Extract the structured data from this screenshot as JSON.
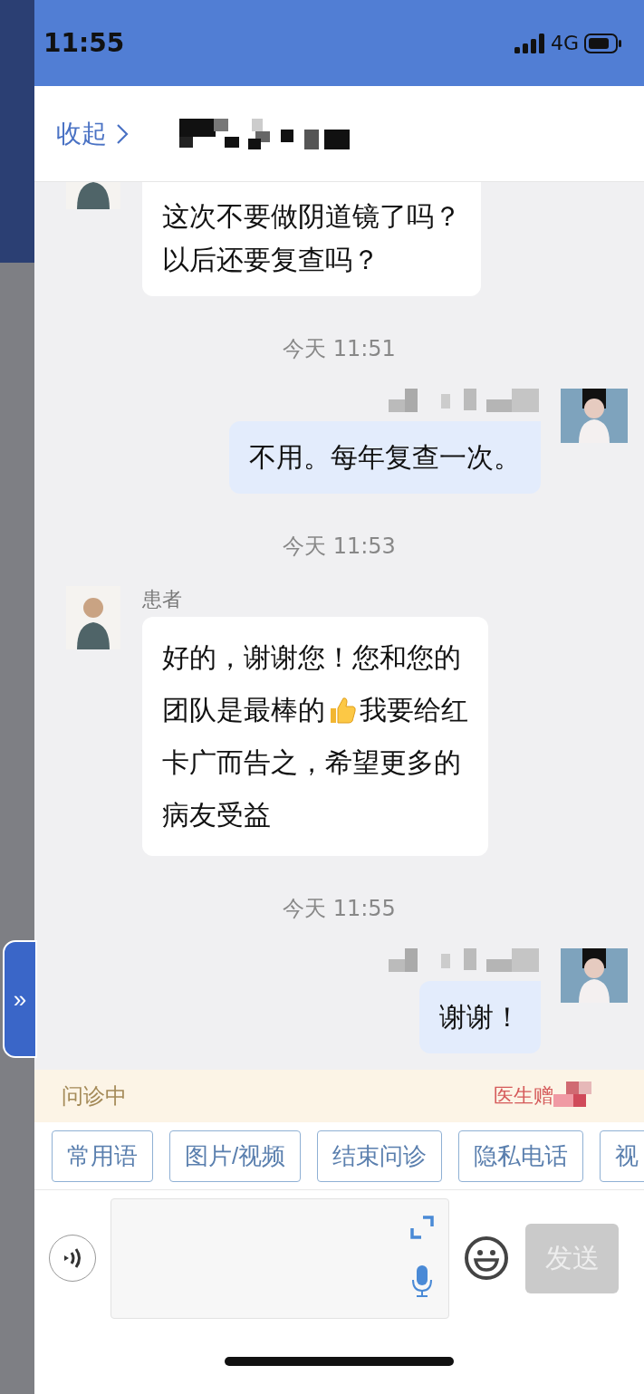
{
  "status_bar": {
    "time": "11:55",
    "network": "4G"
  },
  "header": {
    "collapse_label": "收起"
  },
  "side_tab": {
    "label": "»"
  },
  "messages": [
    {
      "kind": "incoming",
      "lines": [
        "这次不要做阴道镜了吗？",
        "以后还要复查吗？"
      ],
      "cut_top": true
    },
    {
      "kind": "time",
      "text": "今天 11:51"
    },
    {
      "kind": "outgoing",
      "lines": [
        "不用。每年复查一次。"
      ]
    },
    {
      "kind": "time",
      "text": "今天 11:53"
    },
    {
      "kind": "incoming",
      "sender": "患者",
      "segments": [
        [
          "好的，谢谢您！您和您的"
        ],
        [
          "团队是最棒的",
          "我要给红"
        ],
        [
          "卡广而告之，希望更多的"
        ],
        [
          "病友受益"
        ]
      ]
    },
    {
      "kind": "time",
      "text": "今天 11:55"
    },
    {
      "kind": "outgoing",
      "lines": [
        "谢谢！"
      ]
    }
  ],
  "notice_bar": {
    "status": "问诊中",
    "gift": "医生赠"
  },
  "quick_actions": [
    "常用语",
    "图片/视频",
    "结束问诊",
    "隐私电话",
    "视"
  ],
  "send_button": {
    "label": "发送",
    "disabled": true
  }
}
